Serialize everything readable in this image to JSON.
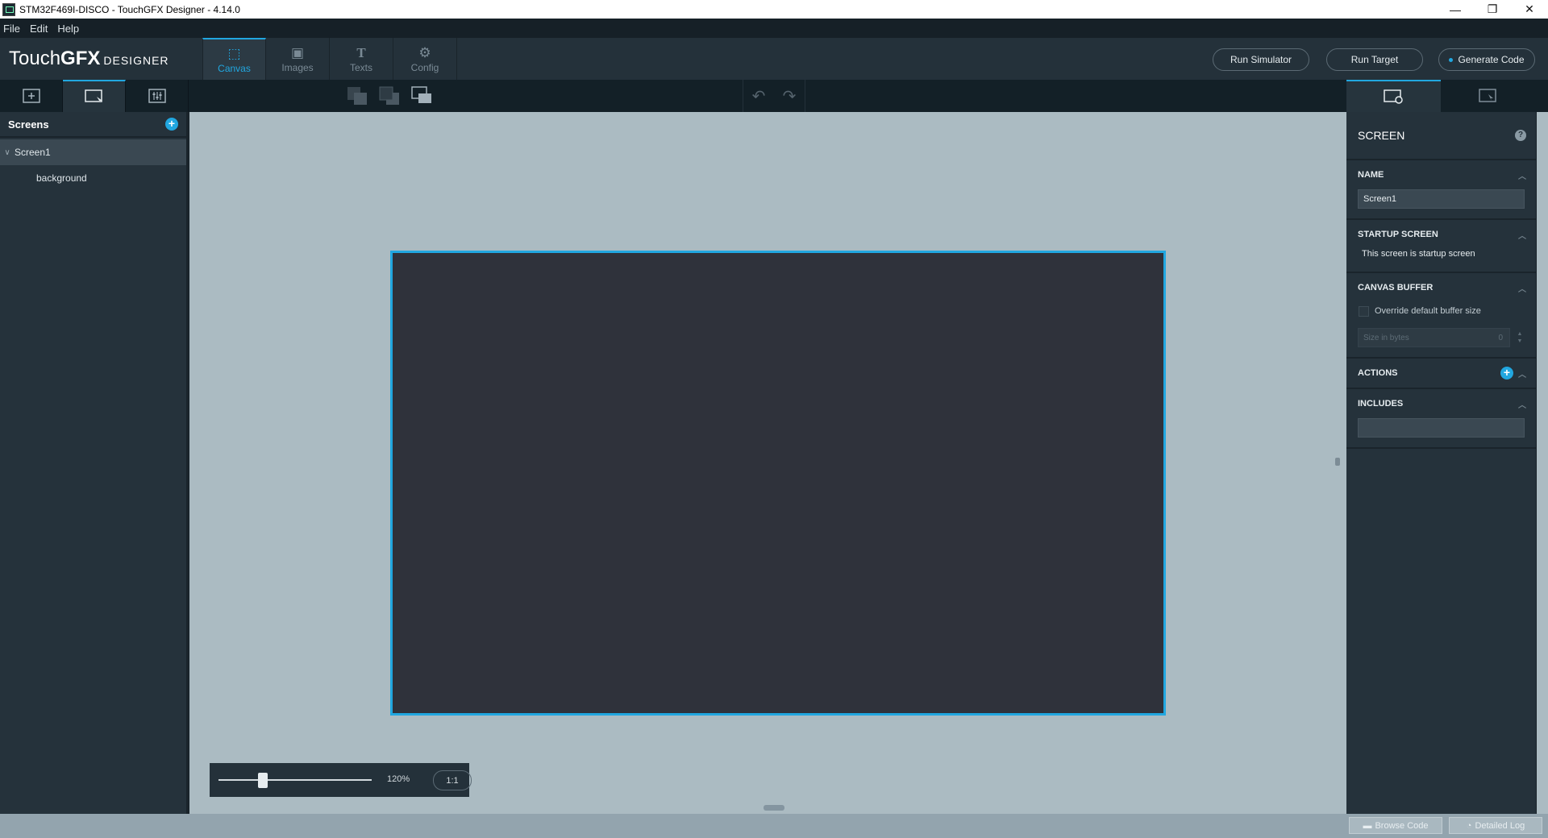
{
  "window": {
    "title": "STM32F469I-DISCO - TouchGFX Designer - 4.14.0",
    "controls": {
      "minimize": "—",
      "restore": "❐",
      "close": "✕"
    }
  },
  "menu": [
    "File",
    "Edit",
    "Help"
  ],
  "logo": {
    "part1": "Touch",
    "part2": "GFX",
    "part3": "DESIGNER"
  },
  "main_tabs": [
    {
      "label": "Canvas",
      "icon": "canvas-icon",
      "glyph": "⬚"
    },
    {
      "label": "Images",
      "icon": "image-icon",
      "glyph": "▣"
    },
    {
      "label": "Texts",
      "icon": "text-icon",
      "glyph": "T"
    },
    {
      "label": "Config",
      "icon": "gear-icon",
      "glyph": "⚙"
    }
  ],
  "actions": {
    "run_simulator": "Run Simulator",
    "run_target": "Run Target",
    "generate_code": "Generate Code"
  },
  "screens_panel": {
    "title": "Screens",
    "tree": [
      {
        "label": "Screen1",
        "level": 0,
        "selected": true
      },
      {
        "label": "background",
        "level": 1,
        "selected": false
      }
    ]
  },
  "zoom": {
    "percent": "120%",
    "reset_label": "1:1"
  },
  "properties": {
    "title": "SCREEN",
    "help": "?",
    "name": {
      "heading": "NAME",
      "value": "Screen1"
    },
    "startup": {
      "heading": "STARTUP SCREEN",
      "text": "This screen is startup screen"
    },
    "canvas_buffer": {
      "heading": "CANVAS BUFFER",
      "override_label": "Override default buffer size",
      "size_placeholder": "Size in bytes",
      "size_value": "0"
    },
    "actions_heading": "ACTIONS",
    "includes_heading": "INCLUDES"
  },
  "bottom": {
    "browse_code": "Browse Code",
    "detailed_log": "Detailed Log"
  },
  "colors": {
    "accent": "#21a7e0",
    "panel": "#25323b",
    "canvas_bg": "#abbbc2",
    "screen_fill": "#2f323b"
  }
}
